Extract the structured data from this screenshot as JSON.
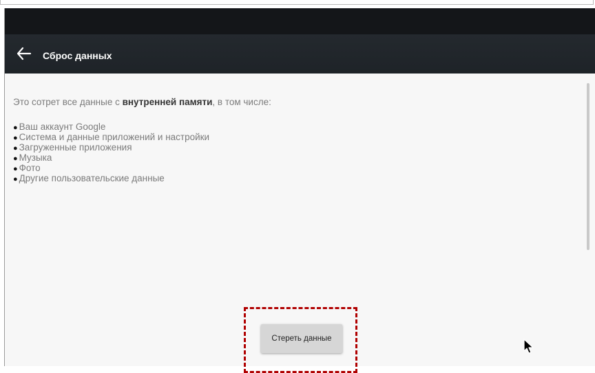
{
  "header": {
    "title": "Сброс данных",
    "back_icon": "arrow-left-icon"
  },
  "content": {
    "intro_before": "Это сотрет все данные с ",
    "intro_bold": "внутренней памяти",
    "intro_after": ", в том числе:",
    "items": [
      "Ваш аккаунт Google",
      "Система и данные приложений и настройки",
      "Загруженные приложения",
      "Музыка",
      "Фото",
      "Другие пользовательские данные"
    ]
  },
  "actions": {
    "erase_label": "Стереть данные"
  },
  "annotations": {
    "highlight_color": "#b00000",
    "cursor_icon": "mouse-pointer-icon"
  }
}
